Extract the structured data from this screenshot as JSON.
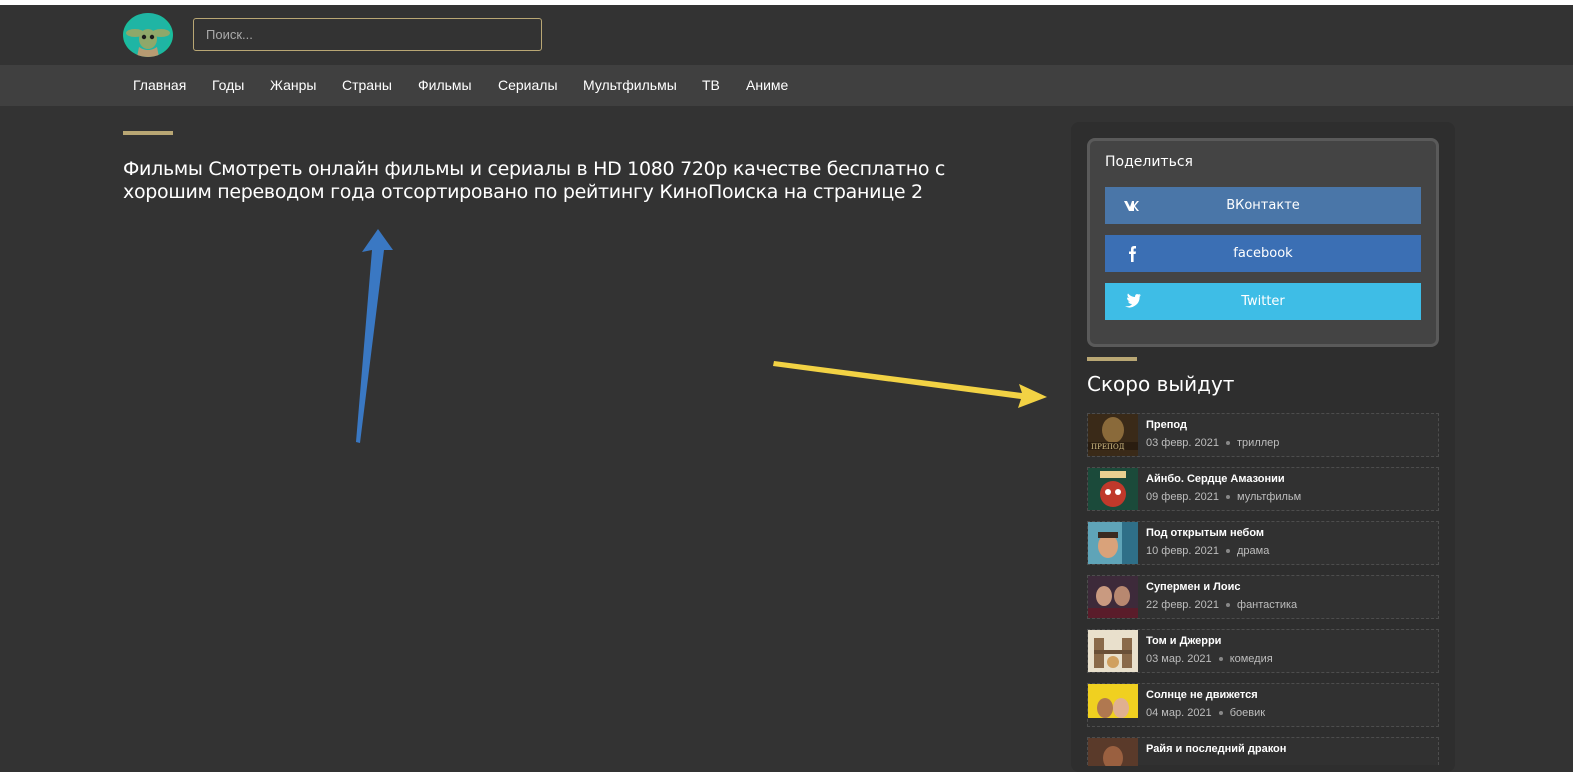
{
  "header": {
    "search_placeholder": "Поиск..."
  },
  "nav": {
    "items": [
      {
        "label": "Главная"
      },
      {
        "label": "Годы"
      },
      {
        "label": "Жанры"
      },
      {
        "label": "Страны"
      },
      {
        "label": "Фильмы"
      },
      {
        "label": "Сериалы"
      },
      {
        "label": "Мультфильмы"
      },
      {
        "label": "ТВ"
      },
      {
        "label": "Аниме"
      }
    ]
  },
  "main": {
    "title_line1": "Фильмы Смотреть онлайн фильмы и сериалы в HD 1080 720p качестве бесплатно с",
    "title_line2": "хорошим переводом года отсортировано по рейтингу КиноПоиска на странице 2"
  },
  "sidebar": {
    "share": {
      "title": "Поделиться",
      "buttons": [
        {
          "label": "ВКонтакте",
          "icon": "vk-icon",
          "color": "#4a76a8"
        },
        {
          "label": "facebook",
          "icon": "facebook-icon",
          "color": "#3b6fb4"
        },
        {
          "label": "Twitter",
          "icon": "twitter-icon",
          "color": "#3ebde6"
        }
      ]
    },
    "soon": {
      "title": "Скоро выйдут",
      "items": [
        {
          "name": "Препод",
          "date": "03 февр. 2021",
          "genre": "триллер"
        },
        {
          "name": "Айнбо. Сердце Амазонии",
          "date": "09 февр. 2021",
          "genre": "мультфильм"
        },
        {
          "name": "Под открытым небом",
          "date": "10 февр. 2021",
          "genre": "драма"
        },
        {
          "name": "Супермен и Лоис",
          "date": "22 февр. 2021",
          "genre": "фантастика"
        },
        {
          "name": "Том и Джерри",
          "date": "03 мар. 2021",
          "genre": "комедия"
        },
        {
          "name": "Солнце не движется",
          "date": "04 мар. 2021",
          "genre": "боевик"
        },
        {
          "name": "Райя и последний дракон",
          "date": "",
          "genre": ""
        }
      ]
    }
  },
  "colors": {
    "accent": "#b9a774",
    "background": "#333333",
    "nav_background": "#404040",
    "annotation_blue": "#3a78c3",
    "annotation_yellow": "#f2d244"
  }
}
